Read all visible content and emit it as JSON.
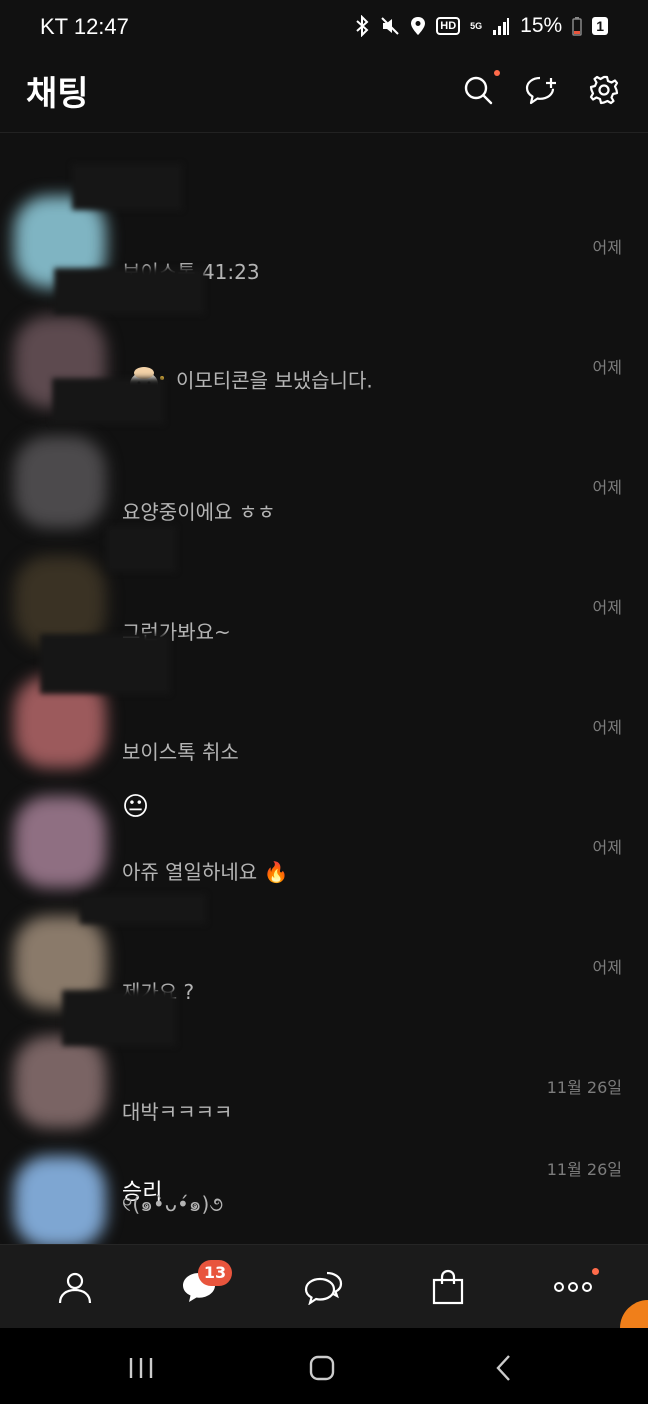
{
  "status_bar": {
    "carrier_time": "KT 12:47",
    "network": "HD",
    "network_5g": "5G",
    "battery": "15%",
    "sim_badge": "1"
  },
  "header": {
    "title": "채팅"
  },
  "chats": [
    {
      "name": "",
      "message": "보이스톡 41:23",
      "time": "어제",
      "avatar_color": "#7fb4c2"
    },
    {
      "name": "",
      "message": "이모티콘을 보냈습니다.",
      "time": "어제",
      "avatar_color": "#5d4a4f",
      "sticker": true
    },
    {
      "name": "",
      "message": "요양중이에요 ㅎㅎ",
      "time": "어제",
      "avatar_color": "#4c4a4c"
    },
    {
      "name": "",
      "message": "그런가봐요~",
      "time": "어제",
      "avatar_color": "#3a3224"
    },
    {
      "name": "",
      "message": "보이스톡 취소",
      "time": "어제",
      "avatar_color": "#9c5a5c"
    },
    {
      "name": "😐",
      "message": "아쥬 열일하네요 🔥",
      "time": "어제",
      "avatar_color": "#8f6f82"
    },
    {
      "name": "",
      "message": "제가요 ?",
      "time": "어제",
      "avatar_color": "#8a7a6a"
    },
    {
      "name": "",
      "message": "대박ㅋㅋㅋㅋ",
      "time": "11월 26일",
      "avatar_color": "#7a6464"
    },
    {
      "name": "승리",
      "message": "୧(๑•̀ᴗ•́๑)૭",
      "time": "11월 26일",
      "avatar_color": "#7ea6d2"
    }
  ],
  "tabbar": {
    "chat_badge": "13"
  },
  "colors": {
    "background": "#111111",
    "accent_badge": "#e8553d",
    "notification_dot": "#ff6b4a"
  },
  "icons": [
    "bluetooth-icon",
    "mute-icon",
    "location-icon",
    "signal-icon",
    "battery-icon",
    "search-icon",
    "new-chat-icon",
    "settings-icon",
    "friends-icon",
    "chat-icon",
    "openchat-icon",
    "shopping-icon",
    "more-icon",
    "recent-apps-icon",
    "home-icon",
    "back-icon"
  ]
}
